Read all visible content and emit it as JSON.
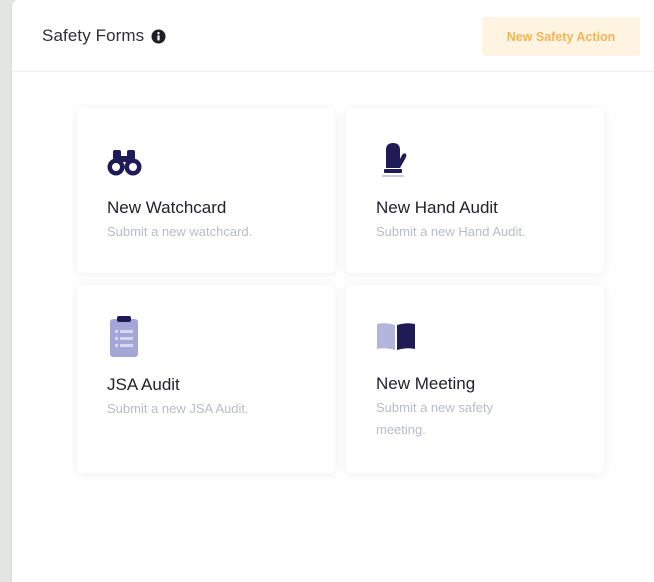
{
  "header": {
    "title": "Safety Forms",
    "info_icon": "info-icon",
    "action_label": "New Safety Action"
  },
  "cards": [
    {
      "title": "New Watchcard",
      "description": "Submit a new watchcard.",
      "icon": "binoculars-icon"
    },
    {
      "title": "New Hand Audit",
      "description": "Submit a new Hand Audit.",
      "icon": "mitten-icon"
    },
    {
      "title": "JSA Audit",
      "description": "Submit a new JSA Audit.",
      "icon": "clipboard-icon"
    },
    {
      "title": "New Meeting",
      "description": "Submit a new safety meeting.",
      "icon": "book-open-icon"
    }
  ],
  "colors": {
    "accent": "#1e1b57",
    "accent_light": "#c6c8e6",
    "action_bg": "#fff4e1",
    "action_text": "#f6b455",
    "muted_text": "#b8bcc8"
  }
}
